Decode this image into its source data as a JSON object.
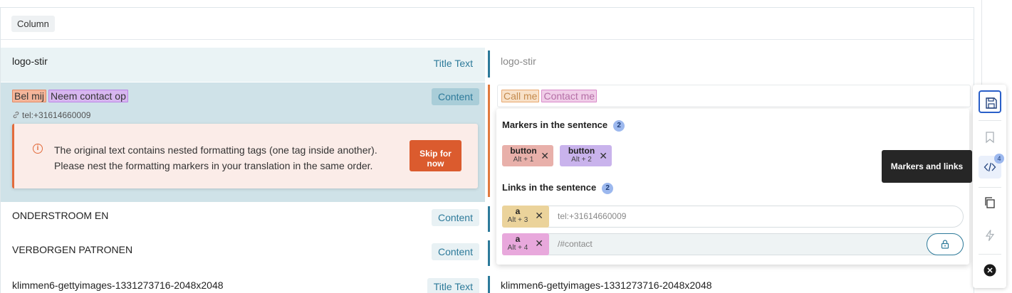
{
  "header": {
    "column_label": "Column"
  },
  "rows": [
    {
      "source": "logo-stir",
      "type": "Title Text",
      "target": "logo-stir"
    },
    {
      "source_tags": [
        "Bel mij",
        "Neem contact op"
      ],
      "source_link": "tel:+31614660009",
      "type": "Content",
      "target_tags": [
        "Call me",
        "Contact me"
      ]
    },
    {
      "source": "ONDERSTROOM EN",
      "type": "Content"
    },
    {
      "source": "VERBORGEN PATRONEN",
      "type": "Content"
    },
    {
      "source": "klimmen6-gettyimages-1331273716-2048x2048",
      "type": "Title Text",
      "target": "klimmen6-gettyimages-1331273716-2048x2048"
    }
  ],
  "alert": {
    "message_line1": "The original text contains nested formatting tags (one tag inside another).",
    "message_line2": "Please nest the formatting markers in your translation in the same order.",
    "skip_line1": "Skip for",
    "skip_line2": "now"
  },
  "popup": {
    "markers_title": "Markers in the sentence",
    "markers_count": "2",
    "markers": [
      {
        "name": "button",
        "hotkey": "Alt + 1",
        "color": "#e8b0aa"
      },
      {
        "name": "button",
        "hotkey": "Alt + 2",
        "color": "#c9b3ec"
      }
    ],
    "links_title": "Links in the sentence",
    "links_count": "2",
    "links": [
      {
        "name": "a",
        "hotkey": "Alt + 3",
        "url": "tel:+31614660009",
        "color": "#ebd39b"
      },
      {
        "name": "a",
        "hotkey": "Alt + 4",
        "url": "/#contact",
        "color": "#e8a8dc"
      }
    ]
  },
  "toolbar": {
    "tooltip": "Markers and links",
    "markers_badge": "4"
  }
}
